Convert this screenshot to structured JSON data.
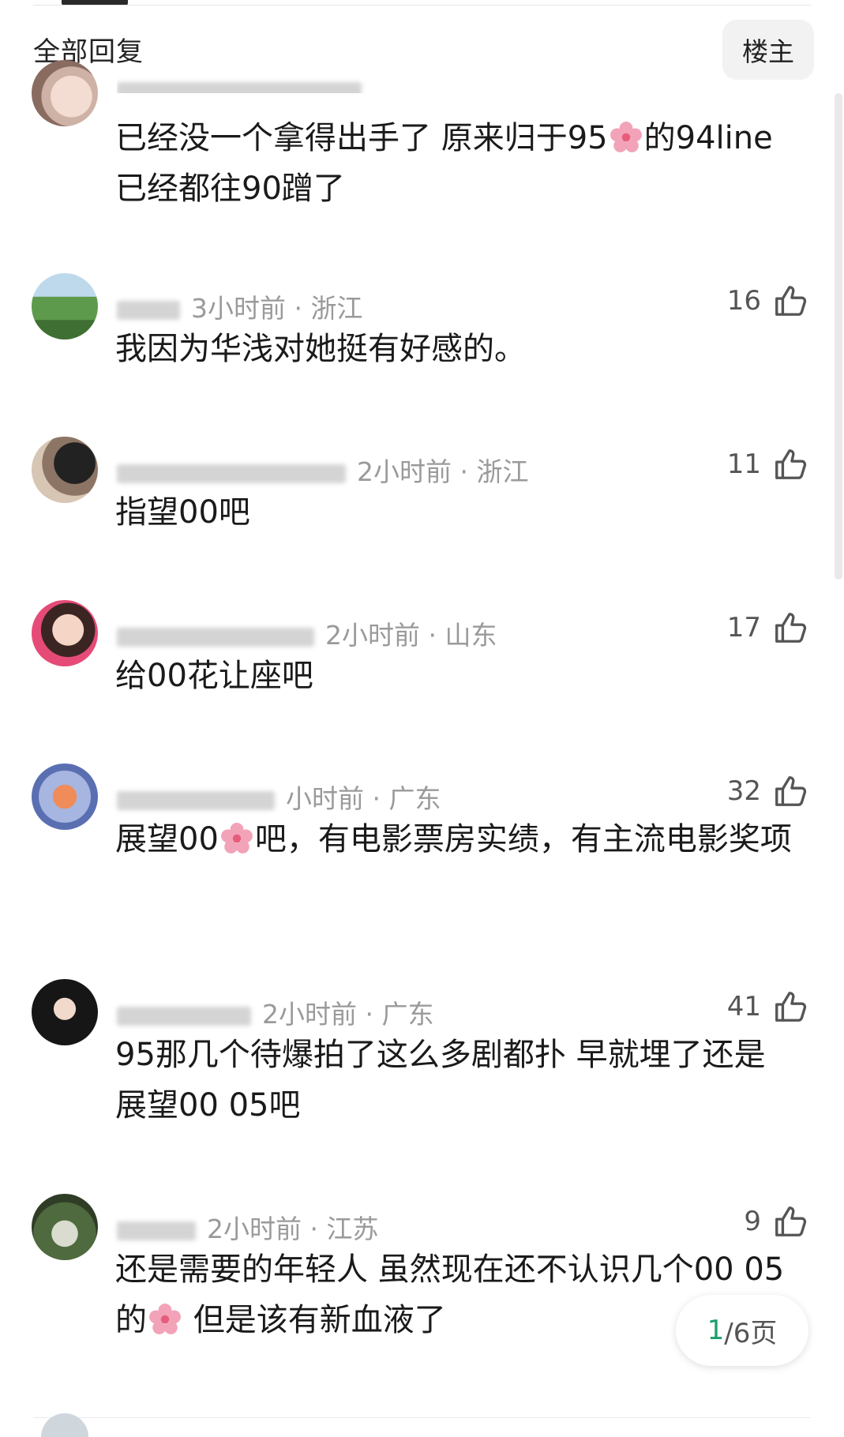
{
  "header": {
    "title": "全部回复",
    "op_button": "楼主"
  },
  "comments": [
    {
      "meta": "",
      "likes": "",
      "text_parts": [
        "已经没一个拿得出手了 原来归于95",
        "的94line已经都往90蹭了"
      ]
    },
    {
      "meta": "3小时前 · 浙江",
      "likes": "16",
      "text_parts": [
        "我因为华浅对她挺有好感的。"
      ]
    },
    {
      "meta": "2小时前 · 浙江",
      "likes": "11",
      "text_parts": [
        "指望00吧"
      ]
    },
    {
      "meta": "2小时前 · 山东",
      "likes": "17",
      "text_parts": [
        "给00花让座吧"
      ]
    },
    {
      "meta": "小时前 · 广东",
      "likes": "32",
      "text_parts": [
        "展望00",
        "吧，有电影票房实绩，有主流电影奖项"
      ]
    },
    {
      "meta": "2小时前 · 广东",
      "likes": "41",
      "text_parts": [
        "95那几个待爆拍了这么多剧都扑 早就埋了还是展望00 05吧"
      ]
    },
    {
      "meta": "2小时前 · 江苏",
      "likes": "9",
      "text_parts": [
        "还是需要的年轻人 虽然现在还不认识几个00 05的",
        " 但是该有新血液了"
      ]
    }
  ],
  "pager": {
    "current": "1",
    "rest": "/6页"
  },
  "icons": {
    "like": "thumbs-up-icon",
    "flower": "cherry-blossom-icon"
  },
  "colors": {
    "accent": "#1a9e6c",
    "meta": "#9a9a9a"
  }
}
